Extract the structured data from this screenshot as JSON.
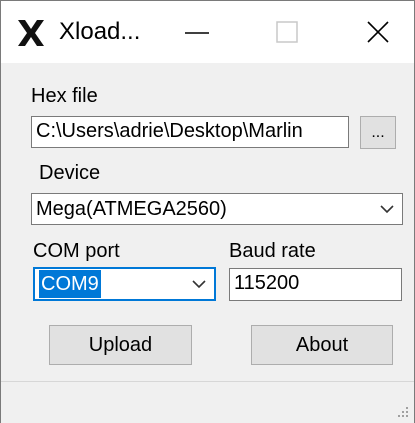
{
  "window": {
    "title": "Xload..."
  },
  "form": {
    "hex_label": "Hex file",
    "hex_value": "C:\\Users\\adrie\\Desktop\\Marlin",
    "browse_label": "...",
    "device_label": "Device",
    "device_value": "Mega(ATMEGA2560)",
    "com_label": "COM port",
    "com_value": "COM9",
    "baud_label": "Baud rate",
    "baud_value": "115200",
    "upload_label": "Upload",
    "about_label": "About"
  },
  "icons": {
    "app": "x-logo-icon",
    "minimize": "minimize-icon",
    "maximize": "maximize-icon",
    "close": "close-icon",
    "dropdown": "chevron-down-icon",
    "grip": "resize-grip-icon"
  },
  "colors": {
    "selection": "#0078d7",
    "window_bg": "#f0f0f0",
    "button_bg": "#e1e1e1"
  }
}
